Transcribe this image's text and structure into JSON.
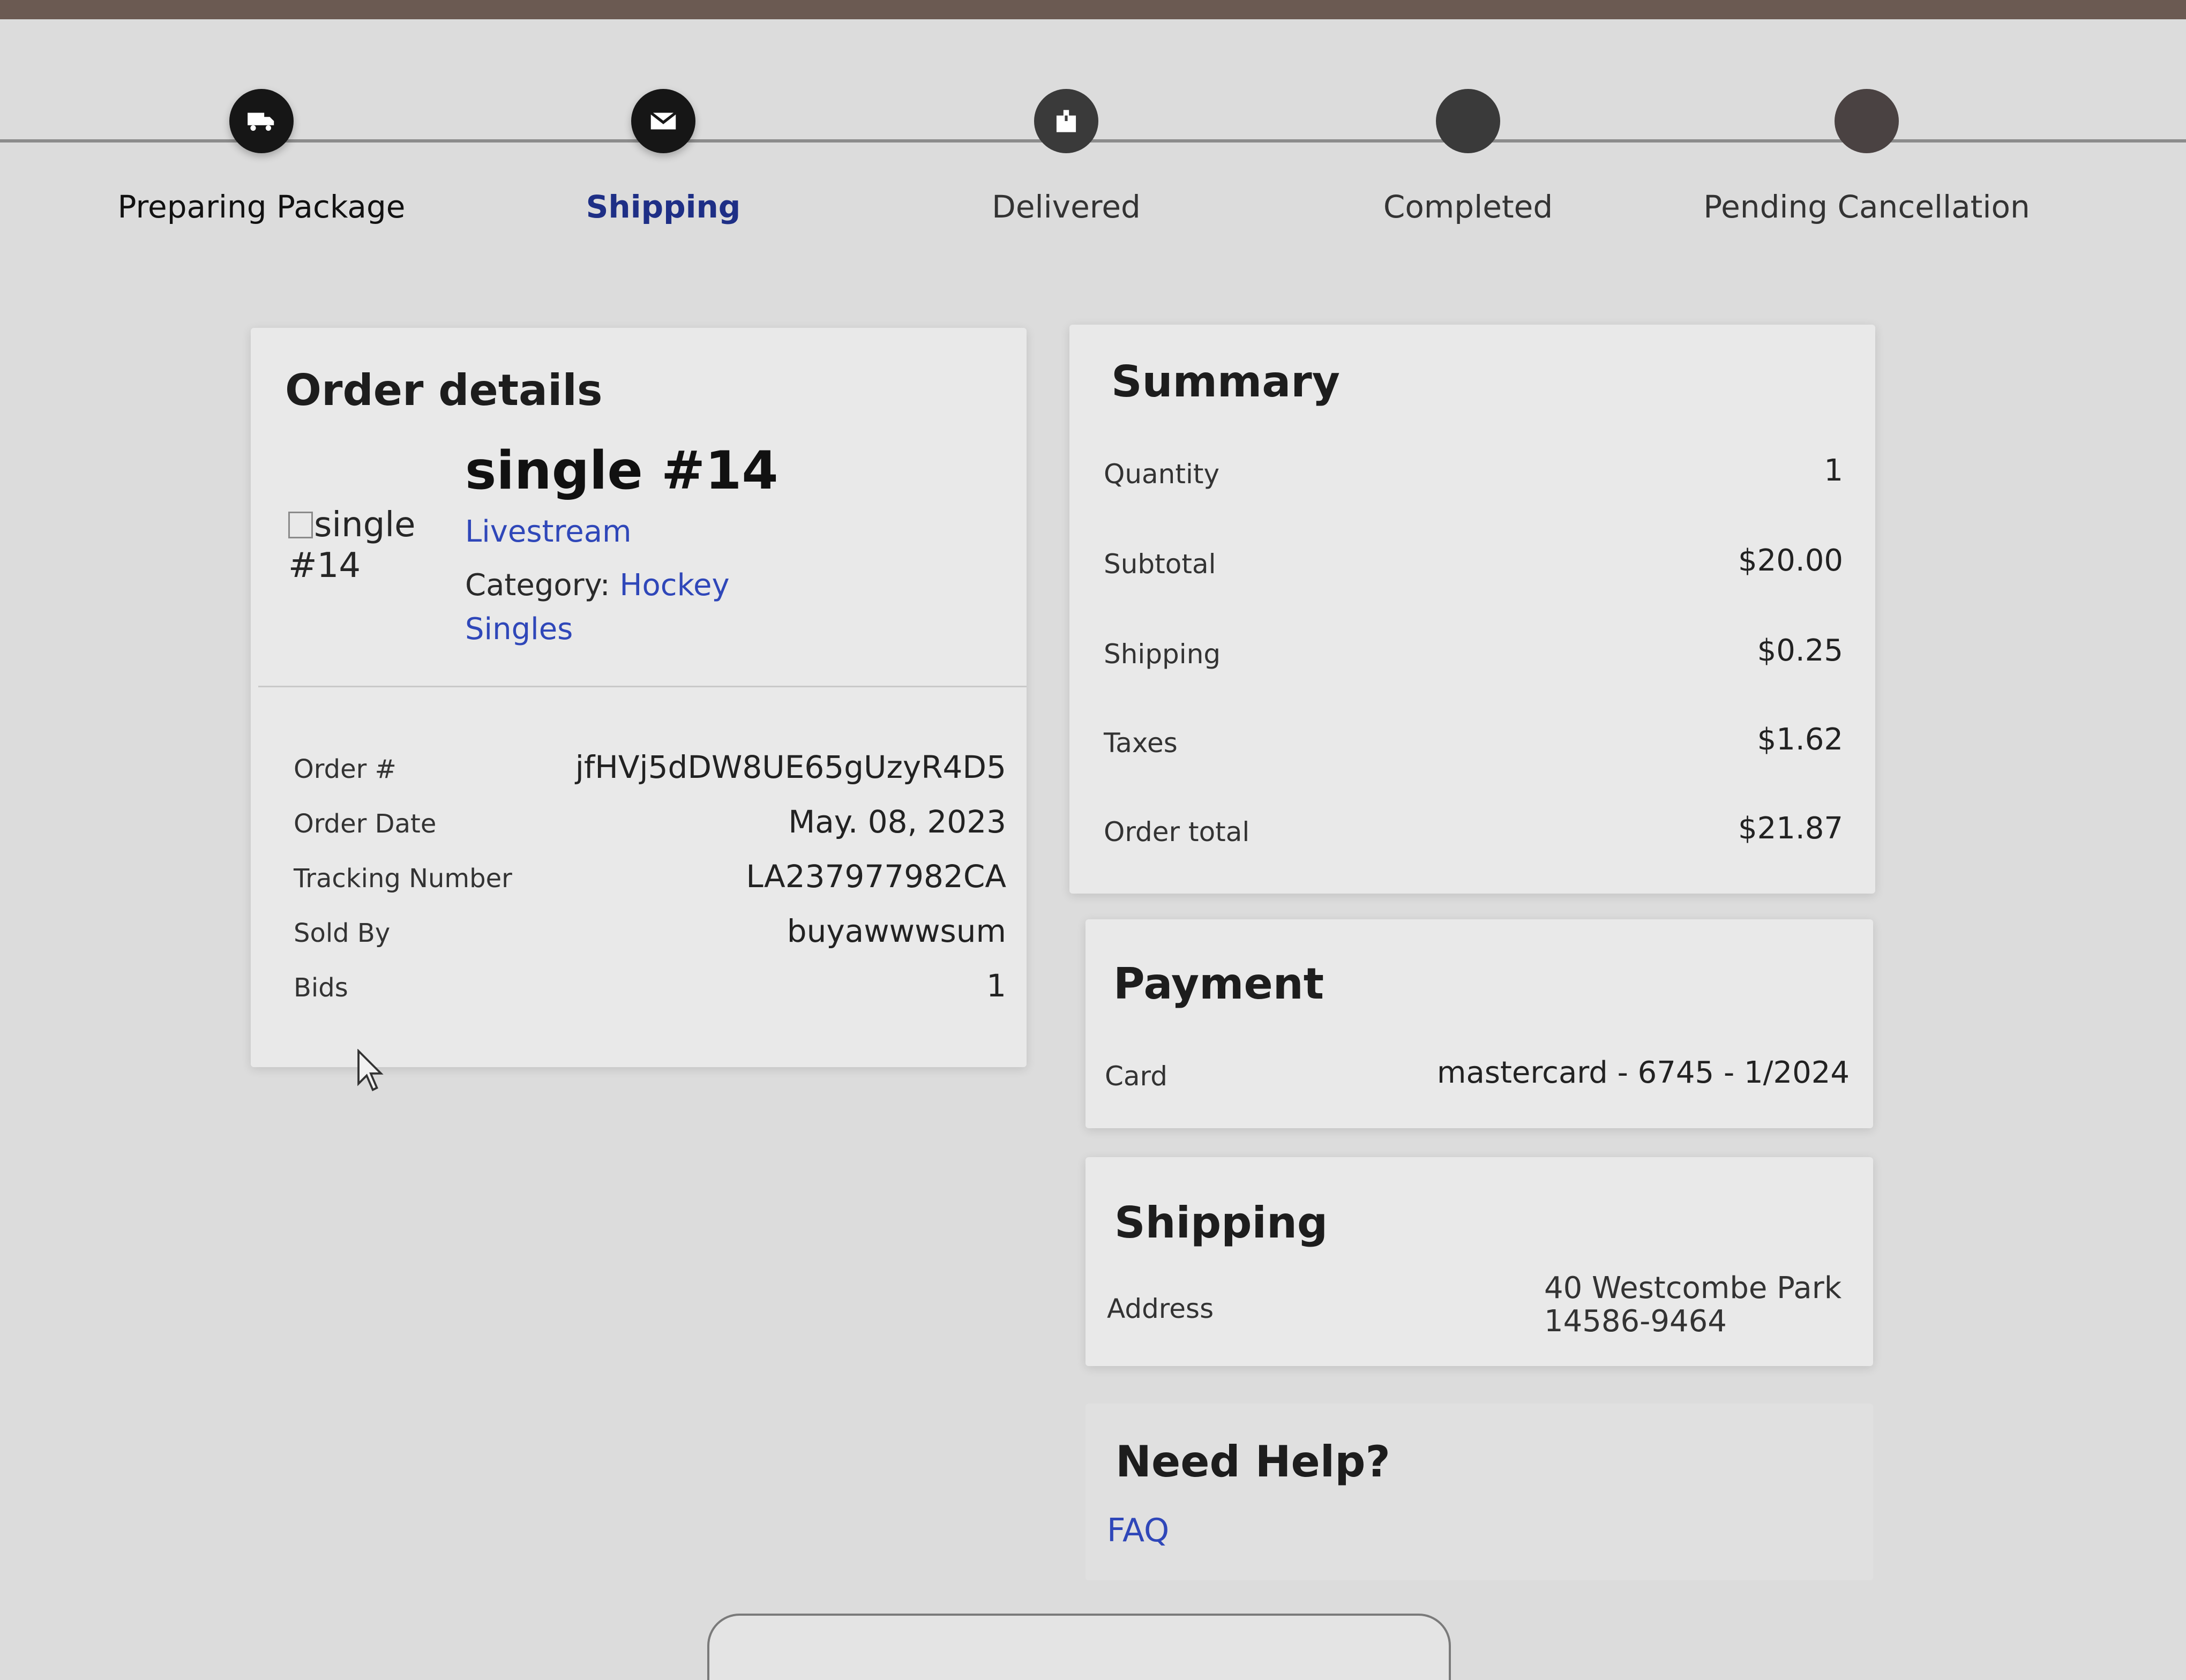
{
  "progress": {
    "steps": [
      {
        "label": "Preparing Package",
        "icon": "truck-icon",
        "state": "done"
      },
      {
        "label": "Shipping",
        "icon": "mail-icon",
        "state": "active"
      },
      {
        "label": "Delivered",
        "icon": "package-icon",
        "state": "pending"
      },
      {
        "label": "Completed",
        "icon": "",
        "state": "pending"
      },
      {
        "label": "Pending Cancellation",
        "icon": "",
        "state": "pending"
      }
    ]
  },
  "order": {
    "title": "Order details",
    "image_alt": "single #14",
    "product_name": "single #14",
    "source": "Livestream",
    "category_label": "Category:",
    "category": "Hockey Singles",
    "rows": [
      {
        "key": "Order #",
        "value": "jfHVj5dDW8UE65gUzyR4D5",
        "link": false
      },
      {
        "key": "Order Date",
        "value": "May. 08, 2023",
        "link": false
      },
      {
        "key": "Tracking Number",
        "value": "LA237977982CA",
        "link": true
      },
      {
        "key": "Sold By",
        "value": "buyawwwsum",
        "link": true
      },
      {
        "key": "Bids",
        "value": "1",
        "link": false
      }
    ]
  },
  "summary": {
    "title": "Summary",
    "rows": [
      {
        "key": "Quantity",
        "value": "1"
      },
      {
        "key": "Subtotal",
        "value": "$20.00"
      },
      {
        "key": "Shipping",
        "value": "$0.25"
      },
      {
        "key": "Taxes",
        "value": "$1.62"
      },
      {
        "key": "Order total",
        "value": "$21.87"
      }
    ]
  },
  "payment": {
    "title": "Payment",
    "card_label": "Card",
    "card_value": "mastercard - 6745 - 1/2024"
  },
  "shipping": {
    "title": "Shipping",
    "address_label": "Address",
    "address_line1": "40 Westcombe Park",
    "address_line2": "14586-9464"
  },
  "help": {
    "title": "Need Help?",
    "faq_link": "FAQ"
  },
  "colors": {
    "link": "#2f47b9",
    "active_step": "#1e2f86",
    "step_done": "#161616",
    "step_pending": "#3a3a3a"
  }
}
